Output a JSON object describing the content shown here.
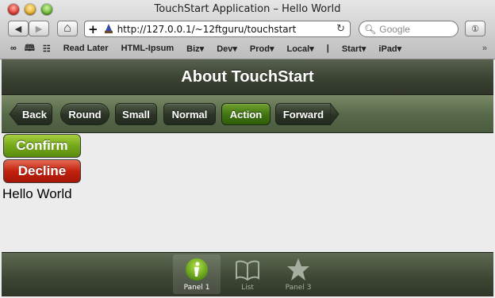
{
  "window": {
    "title": "TouchStart Application – Hello World"
  },
  "toolbar": {
    "back_glyph": "◀",
    "forward_glyph": "▶",
    "home_glyph": "⌂",
    "add_glyph": "+",
    "url": "http://127.0.0.1/~12ftguru/touchstart",
    "reload_glyph": "↻",
    "search_placeholder": "Google",
    "reader_glyph": "①"
  },
  "bookmarks": [
    {
      "label": "Read Later"
    },
    {
      "label": "HTML-Ipsum"
    },
    {
      "label": "Biz▾"
    },
    {
      "label": "Dev▾"
    },
    {
      "label": "Prod▾"
    },
    {
      "label": "Local▾"
    },
    {
      "label": "|"
    },
    {
      "label": "Start▾"
    },
    {
      "label": "iPad▾"
    }
  ],
  "bookmarks_overflow": "»",
  "app": {
    "title": "About TouchStart",
    "buttons": {
      "back": "Back",
      "round": "Round",
      "small": "Small",
      "normal": "Normal",
      "action": "Action",
      "forward": "Forward"
    },
    "confirm": "Confirm",
    "decline": "Decline",
    "hello": "Hello World",
    "tabs": [
      {
        "label": "Panel 1",
        "icon": "info-icon",
        "active": true
      },
      {
        "label": "List",
        "icon": "book-icon",
        "active": false
      },
      {
        "label": "Panel 3",
        "icon": "star-icon",
        "active": false
      }
    ]
  },
  "colors": {
    "action_green": "#3f7311",
    "confirm_green": "#74a81b",
    "decline_red": "#c2210e"
  }
}
